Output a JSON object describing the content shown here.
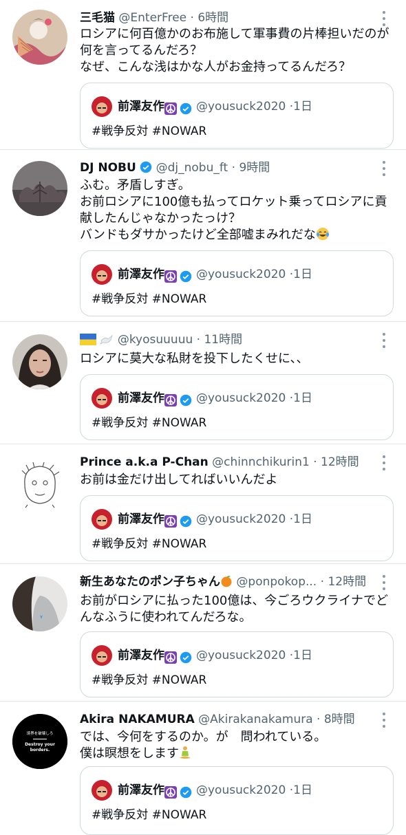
{
  "quoted": {
    "name": "前澤友作",
    "handle": "@yousuck2020",
    "time": "1日",
    "text": "#戦争反対 #NOWAR"
  },
  "tweets": [
    {
      "name": "三毛猫",
      "handle": "@EnterFree",
      "time": "6時間",
      "lines": [
        "ロシアに何百億かのお布施して軍事費の片棒担いだのが",
        "何を言ってるんだろ？",
        "なぜ、こんな浅はかな人がお金持ってるんだろ？"
      ]
    },
    {
      "name": "DJ NOBU",
      "handle": "@dj_nobu_ft",
      "time": "9時間",
      "lines": [
        "ふむ。矛盾しすぎ。",
        "お前ロシアに100億も払ってロケット乗ってロシアに貢",
        "献したんじゃなかったっけ？",
        "バンドもダサかったけど全部嘘まみれだな"
      ]
    },
    {
      "name": "",
      "handle": "@kyosuuuuu",
      "time": "11時間",
      "lines": [
        "ロシアに莫大な私財を投下したくせに、、"
      ]
    },
    {
      "name": "Prince a.k.a P-Chan",
      "handle": "@chinnchikurin1",
      "time": "12時間",
      "lines": [
        "お前は金だけ出してればいいんだよ"
      ]
    },
    {
      "name": "新生あなたのポン子ちゃん",
      "handle": "@ponpokop...",
      "time": "12時間",
      "lines": [
        "お前がロシアに払った100億は、今ごろウクライナでど",
        "んなふうに使われてんだろな。"
      ]
    },
    {
      "name": "Akira NAKAMURA",
      "handle": "@Akirakanakamura",
      "time": "8時間",
      "lines": [
        "では、今何をするのか。が　問われている。",
        "僕は瞑想をします"
      ],
      "avatar_text": [
        "境界を破壊しろ",
        "Destroy your",
        "borders."
      ]
    }
  ],
  "separator": "·",
  "colors": {
    "text": "#0f1419",
    "secondary": "#536471",
    "verified": "#1d9bf0",
    "peace": "#7a3fb5",
    "border": "#cfd9de"
  }
}
